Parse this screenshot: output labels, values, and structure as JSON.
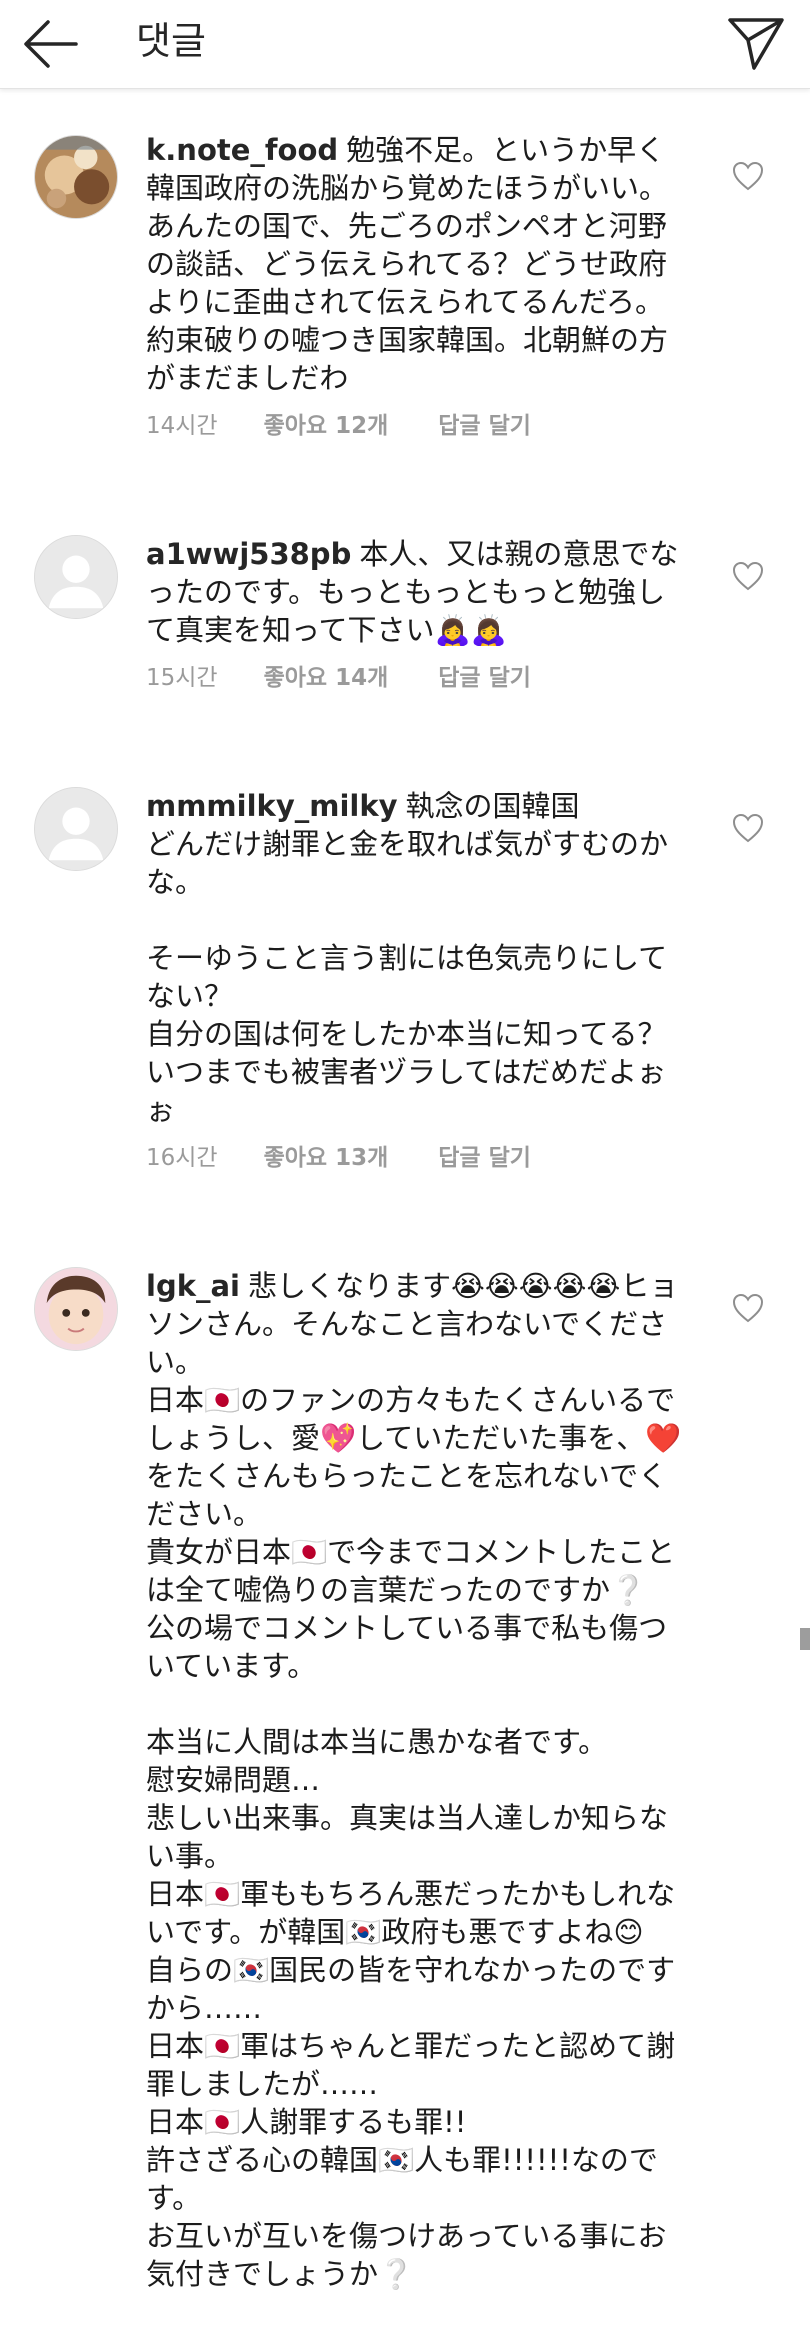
{
  "header": {
    "title": "댓글"
  },
  "comments": [
    {
      "username": "k.note_food",
      "text": "勉強不足。というか早く韓国政府の洗脳から覚めたほうがいい。あんたの国で、先ごろのポンペオと河野の談話、どう伝えられてる？どうせ政府よりに歪曲されて伝えられてるんだろ。約束破りの嘘つき国家韓国。北朝鮮の方がまだましだわ",
      "time": "14시간",
      "likes": "좋아요 12개",
      "reply": "답글 달기",
      "avatar": "food-photo"
    },
    {
      "username": "a1wwj538pb",
      "text": "本人、又は親の意思でなったのです。もっともっともっと勉強して真実を知って下さい🙇‍♀️🙇‍♀️",
      "time": "15시간",
      "likes": "좋아요 14개",
      "reply": "답글 달기",
      "avatar": "default-user"
    },
    {
      "username": "mmmilky_milky",
      "text": "執念の国韓国\nどんだけ謝罪と金を取れば気がすむのかな。\n\nそーゆうこと言う割には色気売りにしてない？\n自分の国は何をしたか本当に知ってる？\nいつまでも被害者ヅラしてはだめだよぉぉ",
      "time": "16시간",
      "likes": "좋아요 13개",
      "reply": "답글 달기",
      "avatar": "default-user"
    },
    {
      "username": "lgk_ai",
      "text": "悲しくなります😭😭😭😭😭ヒョソンさん。そんなこと言わないでください。\n日本🇯🇵のファンの方々もたくさんいるでしょうし、愛💖していただいた事を、❤️をたくさんもらったことを忘れないでください。\n貴女が日本🇯🇵で今までコメントしたことは全て嘘偽りの言葉だったのですか❔\n公の場でコメントしている事で私も傷ついています。\n\n本当に人間は本当に愚かな者です。\n慰安婦問題…\n悲しい出来事。真実は当人達しか知らない事。\n日本🇯🇵軍ももちろん悪だったかもしれないです。が韓国🇰🇷政府も悪ですよね😊\n自らの🇰🇷国民の皆を守れなかったのですから……\n日本🇯🇵軍はちゃんと罪だったと認めて謝罪しましたが……\n日本🇯🇵人謝罪するも罪!!\n許さざる心の韓国🇰🇷人も罪!!!!!!なのです。\nお互いが互いを傷つけあっている事にお気付きでしょうか❔",
      "time": "",
      "likes": "",
      "reply": "",
      "avatar": "baby-photo"
    }
  ]
}
